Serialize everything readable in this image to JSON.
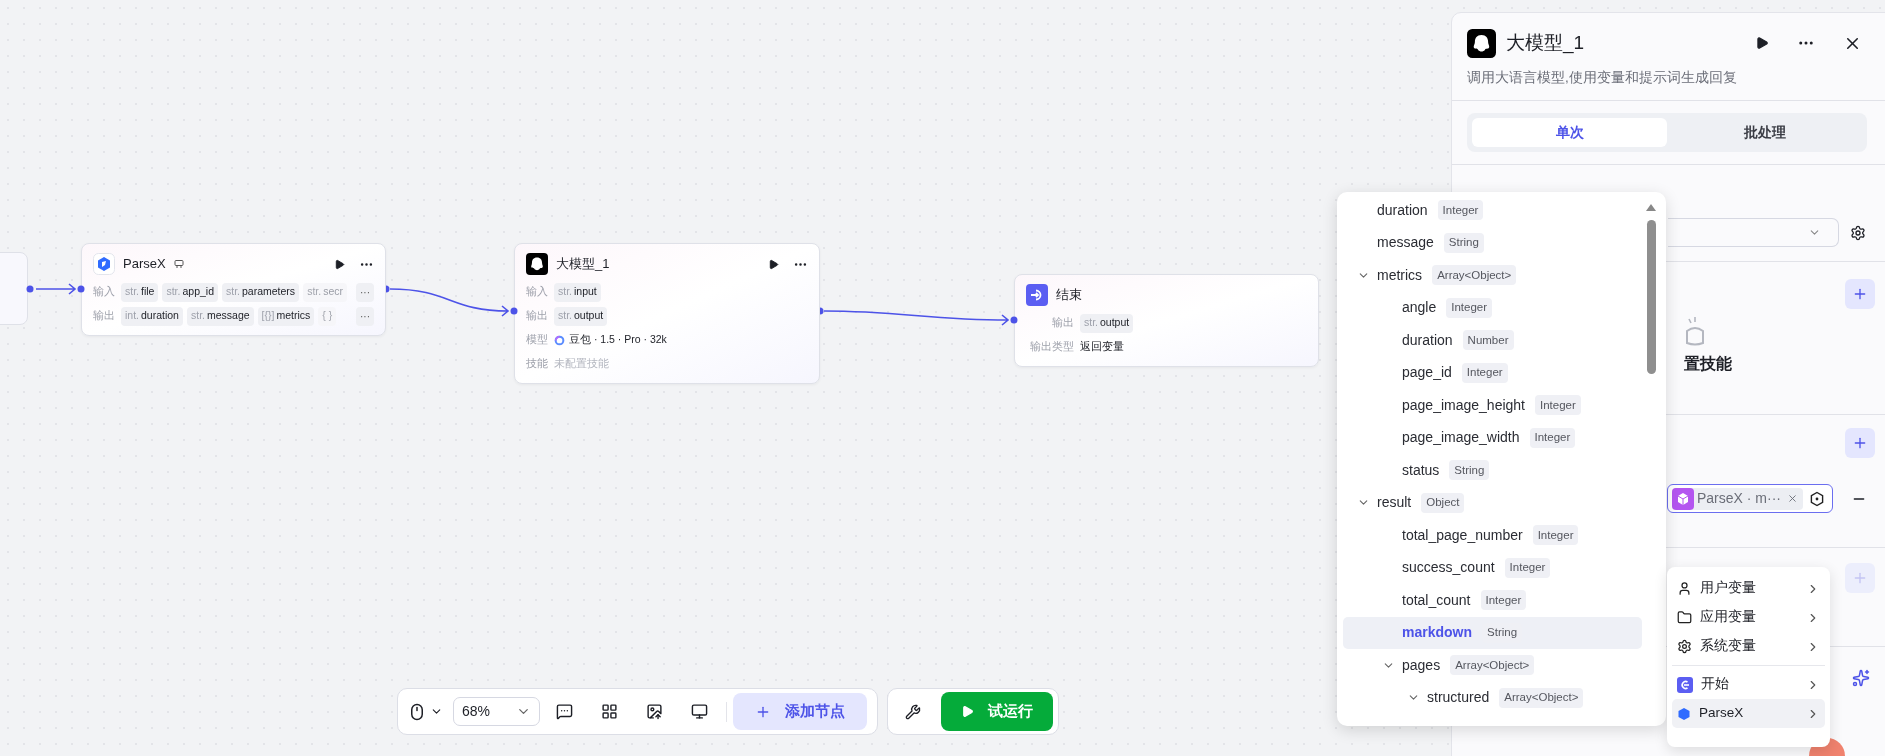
{
  "canvas": {
    "nodes": [
      {
        "kind": "parsex",
        "title": "ParseX",
        "rows": [
          {
            "label": "输入",
            "chips": [
              {
                "prefix": "str.",
                "name": "file",
                "faded": false
              },
              {
                "prefix": "str.",
                "name": "app_id",
                "faded": false
              },
              {
                "prefix": "str.",
                "name": "parameters",
                "faded": false
              },
              {
                "prefix": "str.",
                "name": "secr",
                "faded": true
              }
            ],
            "more": "···"
          },
          {
            "label": "输出",
            "chips": [
              {
                "prefix": "int.",
                "name": "duration",
                "faded": false
              },
              {
                "prefix": "str.",
                "name": "message",
                "faded": false
              },
              {
                "prefix": "[{}]",
                "name": "metrics",
                "faded": false
              },
              {
                "prefix": "{ }",
                "faded": true
              }
            ],
            "more": "···"
          }
        ]
      },
      {
        "kind": "llm",
        "title": "大模型_1",
        "rows": [
          {
            "label": "输入",
            "chips": [
              {
                "prefix": "str.",
                "name": "input",
                "faded": false
              }
            ]
          },
          {
            "label": "输出",
            "chips": [
              {
                "prefix": "str.",
                "name": "output",
                "faded": false
              }
            ]
          },
          {
            "label": "模型",
            "model": "豆包 · 1.5 · Pro · 32k"
          },
          {
            "label": "技能",
            "hint": "未配置技能"
          }
        ]
      },
      {
        "kind": "end",
        "title": "结束",
        "rows": [
          {
            "label": "输出",
            "chips": [
              {
                "prefix": "str.",
                "name": "output",
                "faded": false
              }
            ]
          },
          {
            "label": "输出类型",
            "value": "返回变量"
          }
        ]
      }
    ]
  },
  "toolbar": {
    "zoom": "68%",
    "add_node": "添加节点",
    "run": "试运行"
  },
  "panel": {
    "title": "大模型_1",
    "description": "调用大语言模型,使用变量和提示词生成回复",
    "tabs": [
      {
        "label": "单次",
        "selected": true
      },
      {
        "label": "批处理",
        "selected": false
      }
    ],
    "skill_hint": "置技能",
    "variable_tag": "ParseX · m···"
  },
  "variable_picker": {
    "items": [
      {
        "name": "duration",
        "type": "Integer",
        "selected": false
      },
      {
        "name": "message",
        "type": "String",
        "selected": false
      },
      {
        "name": "metrics",
        "type": "Array<Object>",
        "selected": false,
        "expanded": true,
        "children": [
          {
            "name": "angle",
            "type": "Integer",
            "selected": false
          },
          {
            "name": "duration",
            "type": "Number",
            "selected": false
          },
          {
            "name": "page_id",
            "type": "Integer",
            "selected": false
          },
          {
            "name": "page_image_height",
            "type": "Integer",
            "selected": false
          },
          {
            "name": "page_image_width",
            "type": "Integer",
            "selected": false
          },
          {
            "name": "status",
            "type": "String",
            "selected": false
          }
        ]
      },
      {
        "name": "result",
        "type": "Object",
        "selected": false,
        "expanded": true,
        "children": [
          {
            "name": "total_page_number",
            "type": "Integer",
            "selected": false
          },
          {
            "name": "success_count",
            "type": "Integer",
            "selected": false
          },
          {
            "name": "total_count",
            "type": "Integer",
            "selected": false
          },
          {
            "name": "markdown",
            "type": "String",
            "selected": true
          },
          {
            "name": "pages",
            "type": "Array<Object>",
            "selected": false,
            "expanded": true,
            "children": [
              {
                "name": "structured",
                "type": "Array<Object>",
                "selected": false,
                "expanded": true
              }
            ]
          }
        ]
      }
    ]
  },
  "source_menu": {
    "items": [
      {
        "kind": "user",
        "label": "用户变量",
        "selected": false
      },
      {
        "kind": "folder",
        "label": "应用变量",
        "selected": false
      },
      {
        "kind": "system",
        "label": "系统变量",
        "selected": false
      },
      {
        "kind": "start",
        "label": "开始",
        "selected": false
      },
      {
        "kind": "parsex",
        "label": "ParseX",
        "selected": true
      }
    ]
  }
}
